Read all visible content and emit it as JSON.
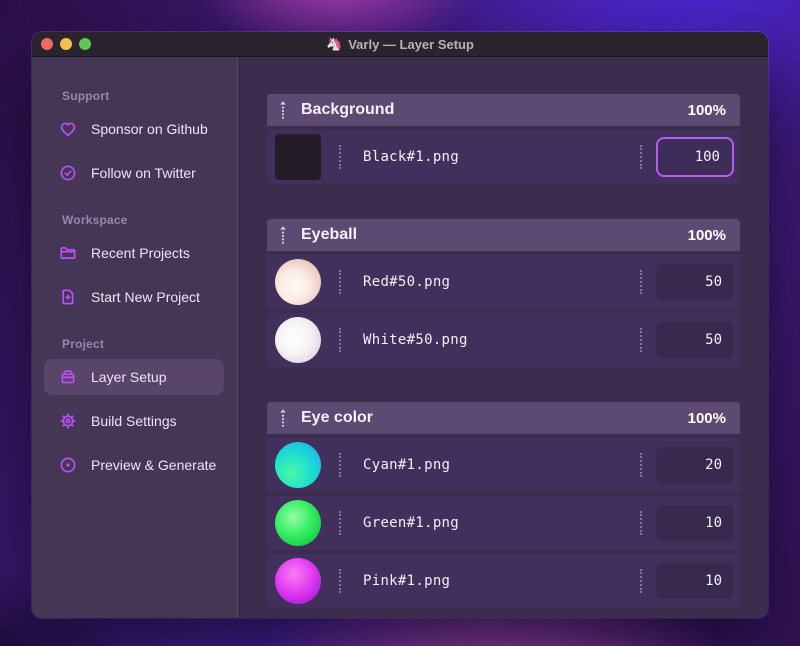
{
  "window": {
    "title": "Varly — Layer Setup",
    "title_icon": "🦄"
  },
  "sidebar": {
    "sections": [
      {
        "label": "Support",
        "items": [
          {
            "label": "Sponsor on Github",
            "icon": "heart-icon"
          },
          {
            "label": "Follow on Twitter",
            "icon": "badge-check-icon"
          }
        ]
      },
      {
        "label": "Workspace",
        "items": [
          {
            "label": "Recent Projects",
            "icon": "folder-icon"
          },
          {
            "label": "Start New Project",
            "icon": "file-plus-icon"
          }
        ]
      },
      {
        "label": "Project",
        "items": [
          {
            "label": "Layer Setup",
            "icon": "layers-icon",
            "active": true
          },
          {
            "label": "Build Settings",
            "icon": "gear-icon"
          },
          {
            "label": "Preview & Generate",
            "icon": "play-circle-icon"
          }
        ]
      }
    ]
  },
  "main": {
    "groups": [
      {
        "name": "Background",
        "weight": "100%",
        "layers": [
          {
            "file": "Black#1.png",
            "value": "100",
            "thumb": "black-square",
            "focused": true
          }
        ]
      },
      {
        "name": "Eyeball",
        "weight": "100%",
        "layers": [
          {
            "file": "Red#50.png",
            "value": "50",
            "thumb": "red-sphere"
          },
          {
            "file": "White#50.png",
            "value": "50",
            "thumb": "white-sphere"
          }
        ]
      },
      {
        "name": "Eye color",
        "weight": "100%",
        "layers": [
          {
            "file": "Cyan#1.png",
            "value": "20",
            "thumb": "cyan-sphere"
          },
          {
            "file": "Green#1.png",
            "value": "10",
            "thumb": "green-sphere"
          },
          {
            "file": "Pink#1.png",
            "value": "10",
            "thumb": "pink-sphere"
          }
        ]
      }
    ]
  },
  "colors": {
    "accent": "#b850f5",
    "focus_border": "#b55cf2",
    "traffic_close": "#ed6a5f",
    "traffic_minimize": "#f5bf4f",
    "traffic_zoom": "#62c554"
  }
}
